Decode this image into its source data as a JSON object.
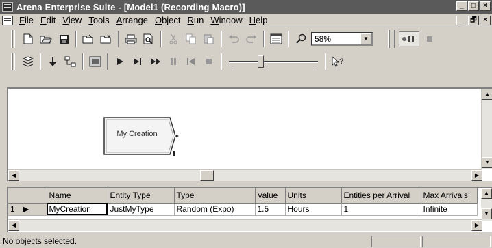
{
  "window": {
    "title": "Arena Enterprise Suite - [Model1 (Recording Macro)]",
    "buttons": [
      "_",
      "□",
      "×"
    ]
  },
  "menubar": {
    "items": [
      {
        "label": "File",
        "u": "F",
        "rest": "ile"
      },
      {
        "label": "Edit",
        "u": "E",
        "rest": "dit"
      },
      {
        "label": "View",
        "u": "V",
        "rest": "iew"
      },
      {
        "label": "Tools",
        "u": "T",
        "rest": "ools"
      },
      {
        "label": "Arrange",
        "u": "A",
        "rest": "rrange"
      },
      {
        "label": "Object",
        "u": "O",
        "rest": "bject"
      },
      {
        "label": "Run",
        "u": "R",
        "rest": "un"
      },
      {
        "label": "Window",
        "u": "W",
        "rest": "indow"
      },
      {
        "label": "Help",
        "u": "H",
        "rest": "elp"
      }
    ],
    "doc_buttons": [
      "_",
      "🗗",
      "×"
    ]
  },
  "toolbar": {
    "zoom_value": "58%",
    "slider_position": 0.35,
    "icons": {
      "new": "new-icon",
      "open": "open-icon",
      "save": "save-icon",
      "attach": "attach-template-icon",
      "detach": "detach-template-icon",
      "print": "print-icon",
      "preview": "print-preview-icon",
      "cut": "cut-icon",
      "copy": "copy-icon",
      "paste": "paste-icon",
      "undo": "undo-icon",
      "redo": "redo-icon",
      "layers": "layers-icon",
      "zoom": "zoom-icon",
      "go": "go-icon",
      "step": "step-icon",
      "fast_forward": "fast-forward-icon",
      "pause": "pause-icon",
      "start_over": "start-over-icon",
      "end": "end-icon",
      "whats_this": "whats-this-icon"
    }
  },
  "model": {
    "module_label": "My Creation"
  },
  "sheet": {
    "columns": [
      "Name",
      "Entity Type",
      "Type",
      "Value",
      "Units",
      "Entities per Arrival",
      "Max Arrivals"
    ],
    "rows": [
      {
        "num": "1",
        "cells": [
          "MyCreation",
          "JustMyType",
          "Random (Expo)",
          "1.5",
          "Hours",
          "1",
          "Infinite"
        ]
      }
    ]
  },
  "statusbar": {
    "text": "No objects selected."
  }
}
